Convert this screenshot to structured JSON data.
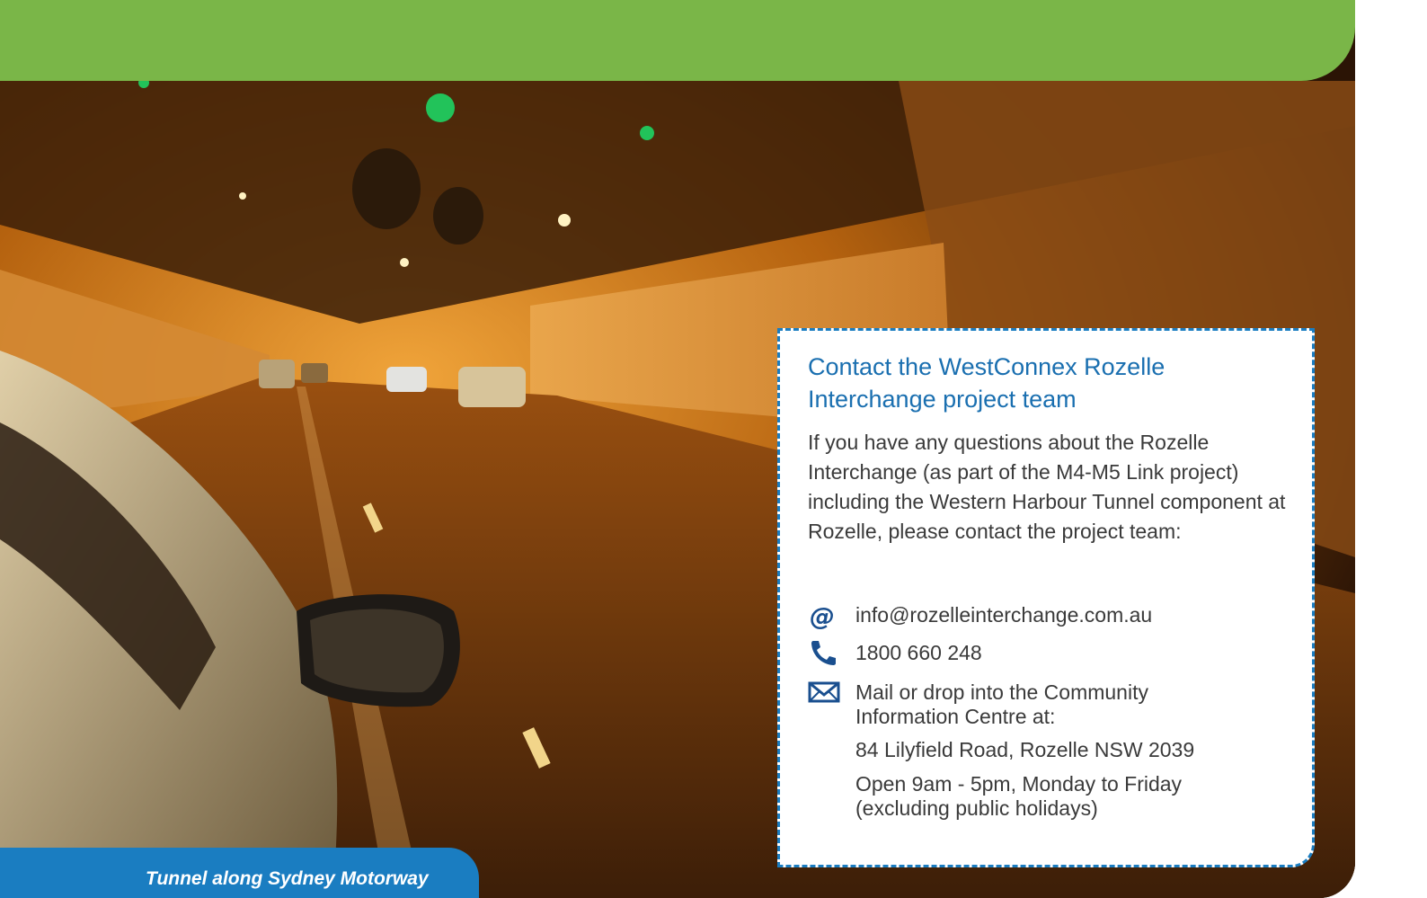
{
  "caption": "Tunnel along Sydney Motorway",
  "contact": {
    "title": "Contact the WestConnex Rozelle Interchange project team",
    "intro": "If you have any questions about the Rozelle Interchange (as part of the M4-M5 Link project) including the Western Harbour Tunnel component at Rozelle, please contact the project team:",
    "email": "info@rozelleinterchange.com.au",
    "phone": "1800 660 248",
    "mail_intro": "Mail or drop into the Community Information Centre at:",
    "address": "84 Lilyfield Road, Rozelle NSW 2039",
    "hours": "Open 9am - 5pm, Monday to Friday (excluding public holidays)"
  },
  "colors": {
    "green_band": "#7ab648",
    "accent_blue": "#1a7dc1",
    "title_blue": "#1a6fb0",
    "body_text": "#3a3a3a"
  },
  "icons": [
    "at-icon",
    "phone-icon",
    "envelope-icon"
  ]
}
